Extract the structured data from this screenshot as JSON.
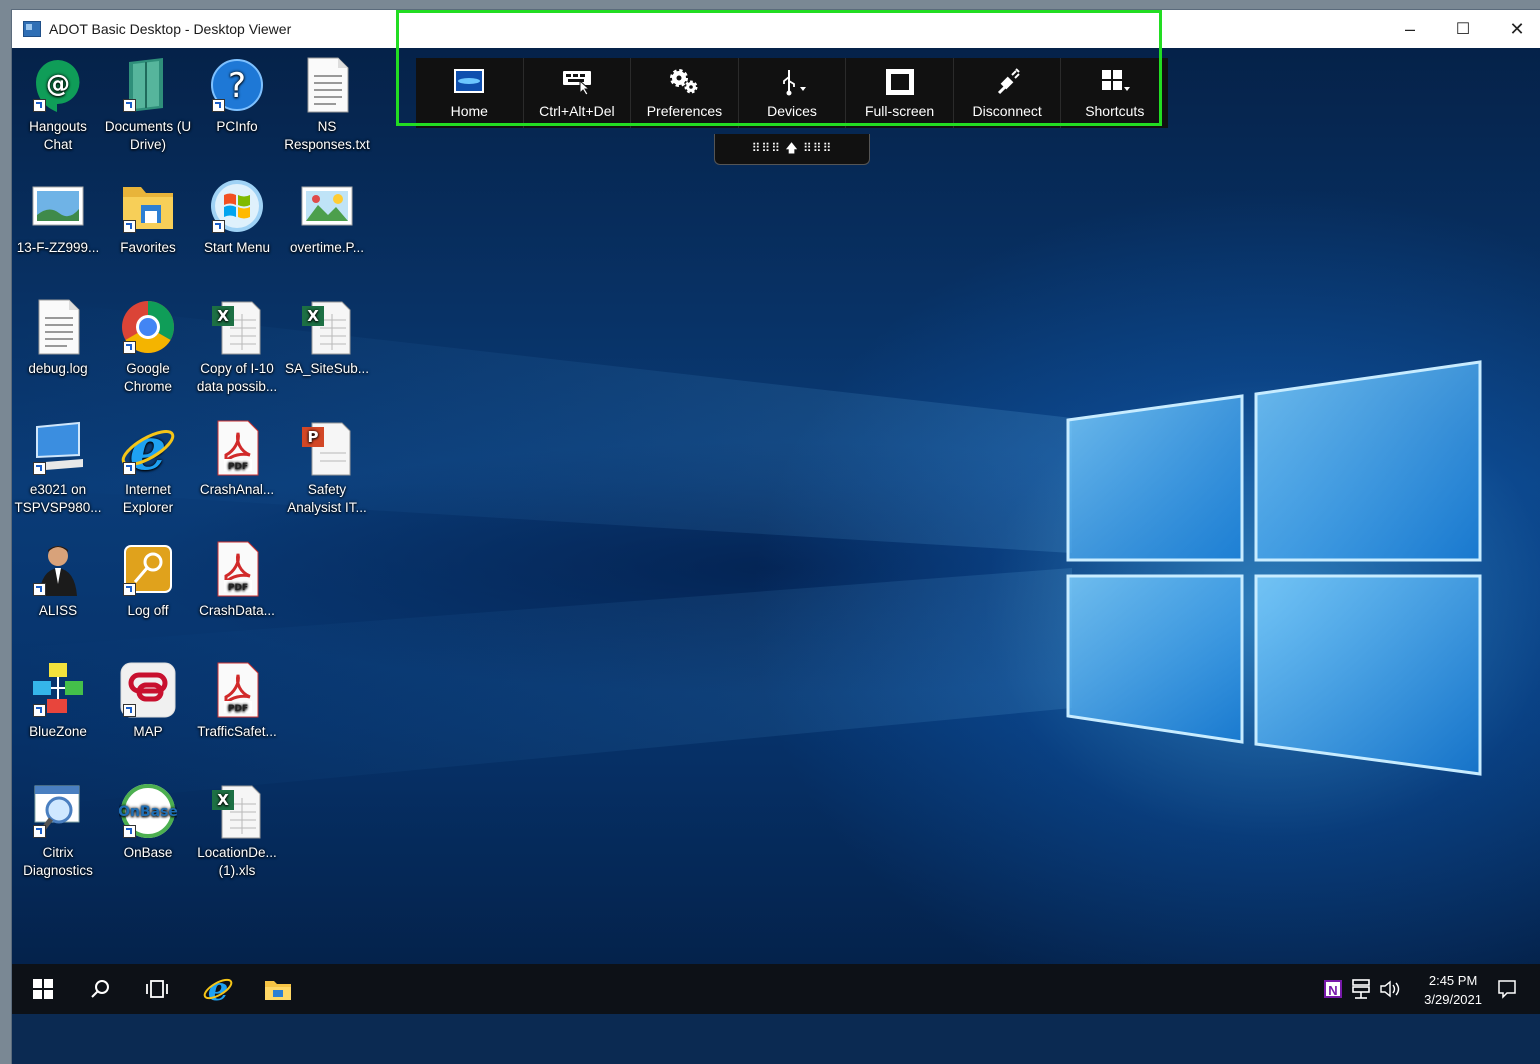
{
  "window": {
    "title": "ADOT Basic Desktop - Desktop Viewer",
    "minimize_glyph": "–",
    "maximize_glyph": "☐",
    "close_glyph": "✕"
  },
  "toolbar": {
    "items": [
      {
        "label": "Home",
        "icon": "home-icon"
      },
      {
        "label": "Ctrl+Alt+Del",
        "icon": "ctrl-alt-del-icon"
      },
      {
        "label": "Preferences",
        "icon": "gears-icon"
      },
      {
        "label": "Devices",
        "icon": "usb-icon"
      },
      {
        "label": "Full-screen",
        "icon": "fullscreen-icon"
      },
      {
        "label": "Disconnect",
        "icon": "plug-icon"
      },
      {
        "label": "Shortcuts",
        "icon": "grid-icon"
      }
    ],
    "handle_text": "⠿⠿⠿ 🡅 ⠿⠿⠿"
  },
  "desktop": {
    "icons": [
      {
        "label": "Hangouts Chat",
        "icon": "hangouts-icon"
      },
      {
        "label": "Documents (U Drive)",
        "icon": "documents-icon"
      },
      {
        "label": "PCInfo",
        "icon": "help-icon"
      },
      {
        "label": "NS Responses.txt",
        "icon": "text-file-icon"
      },
      {
        "label": "13-F-ZZ999...",
        "icon": "image-file-icon"
      },
      {
        "label": "Favorites",
        "icon": "folder-icon"
      },
      {
        "label": "Start Menu",
        "icon": "windows-orb-icon"
      },
      {
        "label": "overtime.P...",
        "icon": "picture-file-icon"
      },
      {
        "label": "debug.log",
        "icon": "text-file-icon"
      },
      {
        "label": "Google Chrome",
        "icon": "chrome-icon"
      },
      {
        "label": "Copy of I-10 data possib...",
        "icon": "excel-file-icon"
      },
      {
        "label": "SA_SiteSub...",
        "icon": "excel-file-icon"
      },
      {
        "label": "e3021 on TSPVSP980...",
        "icon": "computer-icon"
      },
      {
        "label": "Internet Explorer",
        "icon": "ie-icon"
      },
      {
        "label": "CrashAnal...",
        "icon": "pdf-file-icon"
      },
      {
        "label": "Safety Analysist IT...",
        "icon": "powerpoint-file-icon"
      },
      {
        "label": "ALISS",
        "icon": "person-icon"
      },
      {
        "label": "Log off",
        "icon": "key-icon"
      },
      {
        "label": "CrashData...",
        "icon": "pdf-file-icon"
      },
      {
        "label": "BlueZone",
        "icon": "network-icon"
      },
      {
        "label": "MAP",
        "icon": "map-app-icon"
      },
      {
        "label": "TrafficSafet...",
        "icon": "pdf-file-icon"
      },
      {
        "label": "Citrix Diagnostics",
        "icon": "diagnostics-icon"
      },
      {
        "label": "OnBase",
        "icon": "onbase-icon"
      },
      {
        "label": "LocationDe... (1).xls",
        "icon": "excel-file-icon"
      }
    ],
    "onbase_text": "OnBase",
    "pdf_text": "PDF"
  },
  "taskbar": {
    "time": "2:45 PM",
    "date": "3/29/2021",
    "onenote_text": "N"
  },
  "colors": {
    "highlight": "#22dd22",
    "toolbar_bg": "#111111",
    "taskbar_bg": "#0d1117"
  }
}
